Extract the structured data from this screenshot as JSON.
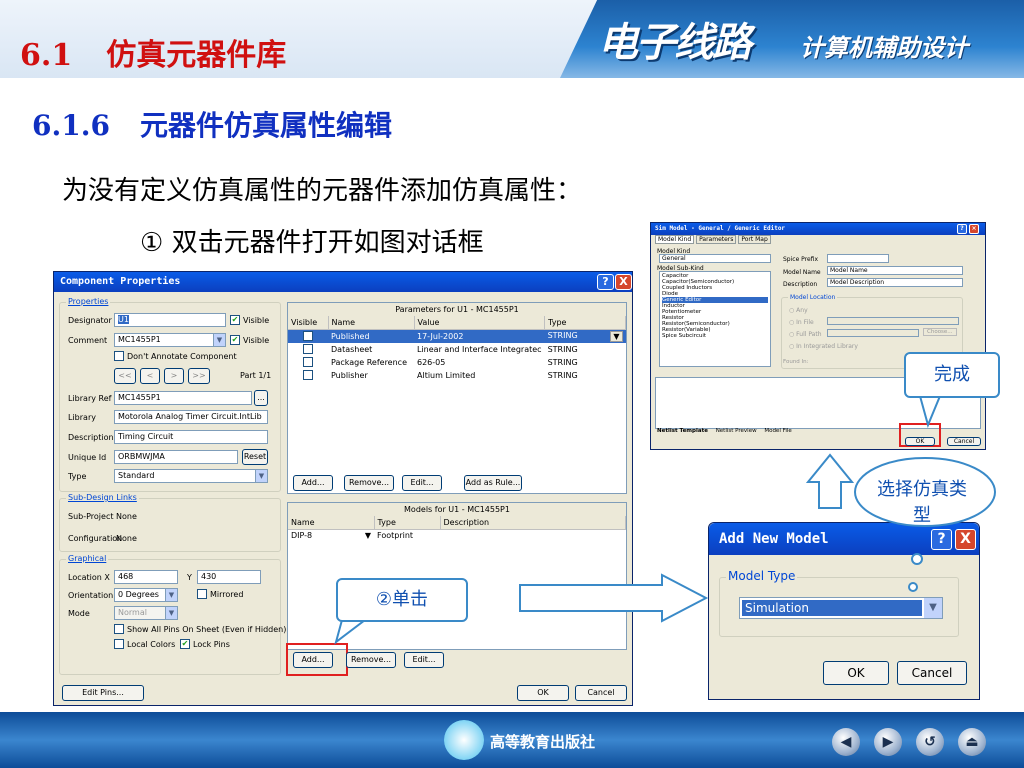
{
  "header": {
    "section_no": "6.1",
    "section_title": "仿真元器件库",
    "logo_main": "电子线路",
    "logo_sub": "计算机辅助设计"
  },
  "subsection": {
    "no": "6.1.6",
    "title": "元器件仿真属性编辑"
  },
  "body": {
    "line1": "为没有定义仿真属性的元器件添加仿真属性：",
    "line2": "① 双击元器件打开如图对话框"
  },
  "component_dialog": {
    "title": "Component Properties",
    "properties_label": "Properties",
    "designator_label": "Designator",
    "designator_value": "U1",
    "visible_label": "Visible",
    "comment_label": "Comment",
    "comment_value": "MC1455P1",
    "dont_annotate": "Don't Annotate Component",
    "part_label": "Part 1/1",
    "nav_first": "<<",
    "nav_prev": "<",
    "nav_next": ">",
    "nav_last": ">>",
    "libref_label": "Library Ref",
    "libref_value": "MC1455P1",
    "library_label": "Library",
    "library_value": "Motorola Analog Timer Circuit.IntLib",
    "description_label": "Description",
    "description_value": "Timing Circuit",
    "uniqueid_label": "Unique Id",
    "uniqueid_value": "ORBMWJMA",
    "reset_label": "Reset",
    "type_label": "Type",
    "type_value": "Standard",
    "subdesign_label": "Sub-Design Links",
    "subproject_label": "Sub-Project",
    "subproject_value": "None",
    "config_label": "Configuration",
    "config_value": "None",
    "graphical_label": "Graphical",
    "location_label": "Location X",
    "loc_x": "468",
    "loc_y_label": "Y",
    "loc_y": "430",
    "orientation_label": "Orientation",
    "orientation_value": "0 Degrees",
    "mirrored_label": "Mirrored",
    "mode_label": "Mode",
    "mode_value": "Normal",
    "show_pins": "Show All Pins On Sheet (Even if Hidden)",
    "local_colors": "Local Colors",
    "lock_pins": "Lock Pins",
    "params_title": "Parameters for U1 - MC1455P1",
    "params_headers": [
      "Visible",
      "Name",
      "Value",
      "Type"
    ],
    "params_rows": [
      {
        "name": "Published",
        "value": "17-Jul-2002",
        "type": "STRING"
      },
      {
        "name": "Datasheet",
        "value": "Linear and Interface Integratec",
        "type": "STRING"
      },
      {
        "name": "Package Reference",
        "value": "626-05",
        "type": "STRING"
      },
      {
        "name": "Publisher",
        "value": "Altium Limited",
        "type": "STRING"
      }
    ],
    "btn_add": "Add...",
    "btn_remove": "Remove...",
    "btn_edit": "Edit...",
    "btn_add_rule": "Add as Rule...",
    "models_title": "Models for U1 - MC1455P1",
    "models_headers": [
      "Name",
      "Type",
      "Description"
    ],
    "models_rows": [
      {
        "name": "DIP-8",
        "type": "Footprint",
        "description": ""
      }
    ],
    "btn_add2": "Add...",
    "btn_remove2": "Remove...",
    "btn_edit2": "Edit...",
    "btn_edit_pins": "Edit Pins...",
    "btn_ok": "OK",
    "btn_cancel": "Cancel",
    "help": "?",
    "close": "X"
  },
  "sim_dialog": {
    "title": "Sim Model - General / Generic Editor",
    "tabs": [
      "Model Kind",
      "Parameters",
      "Port Map"
    ],
    "model_kind_label": "Model Kind",
    "model_kind_value": "General",
    "model_subkind_label": "Model Sub-Kind",
    "subkinds": [
      "Capacitor",
      "Capacitor(Semiconductor)",
      "Coupled Inductors",
      "Diode",
      "Generic Editor",
      "Inductor",
      "Potentiometer",
      "Resistor",
      "Resistor(Semiconductor)",
      "Resistor(Variable)",
      "Spice Subcircuit"
    ],
    "spice_prefix_label": "Spice Prefix",
    "model_name_label": "Model Name",
    "model_name_value": "Model Name",
    "description_label": "Description",
    "description_value": "Model Description",
    "model_location_label": "Model Location",
    "loc_any": "Any",
    "loc_in_file": "In File",
    "loc_full_path": "Full Path",
    "choose": "Choose...",
    "loc_integrated": "In Integrated Library",
    "found_in": "Found In:",
    "bottom_tabs": [
      "Netlist Template",
      "Netlist Preview",
      "Model File"
    ],
    "btn_ok": "OK",
    "btn_cancel": "Cancel"
  },
  "add_model_dialog": {
    "title": "Add New Model",
    "model_type_label": "Model Type",
    "model_type_value": "Simulation",
    "btn_ok": "OK",
    "btn_cancel": "Cancel",
    "help": "?",
    "close": "X"
  },
  "callouts": {
    "done": "完成",
    "select_sim_type": "选择仿真类型",
    "single_click": "②单击"
  },
  "footer": {
    "publisher": "高等教育出版社"
  }
}
